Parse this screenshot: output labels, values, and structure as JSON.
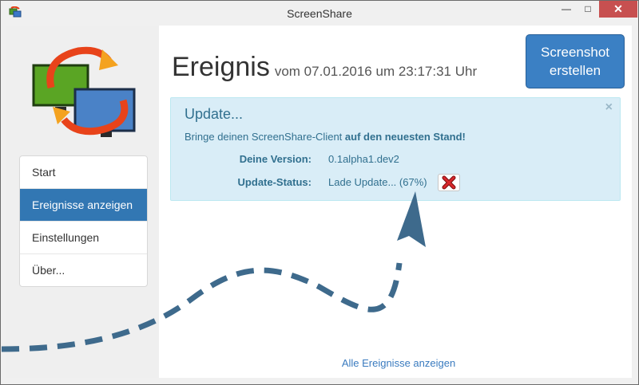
{
  "window": {
    "title": "ScreenShare",
    "min_icon": "minimize-icon",
    "max_icon": "maximize-icon",
    "close_icon": "close-icon"
  },
  "sidebar": {
    "logo_icon": "screenshare-logo",
    "items": [
      {
        "label": "Start",
        "active": false
      },
      {
        "label": "Ereignisse anzeigen",
        "active": true
      },
      {
        "label": "Einstellungen",
        "active": false
      },
      {
        "label": "Über...",
        "active": false
      }
    ]
  },
  "main": {
    "title": "Ereignis",
    "subtitle": "vom 07.01.2016 um 23:17:31 Uhr",
    "screenshot_button": {
      "line1": "Screenshot",
      "line2": "erstellen"
    },
    "alert": {
      "title": "Update...",
      "text_prefix": "Bringe deinen ScreenShare-Client ",
      "text_bold": "auf den neuesten Stand!",
      "close_glyph": "×",
      "version_label": "Deine Version:",
      "version_value": "0.1alpha1.dev2",
      "status_label": "Update-Status:",
      "status_value": "Lade Update... (67%)",
      "progress": 0.67,
      "cancel_icon": "cancel-x-icon"
    },
    "all_link": "Alle Ereignisse anzeigen"
  },
  "colors": {
    "accent": "#3277b3",
    "alert_bg": "#d9edf7",
    "alert_text": "#31708f",
    "close_red": "#c75050",
    "arrow": "#3e6a8c"
  }
}
